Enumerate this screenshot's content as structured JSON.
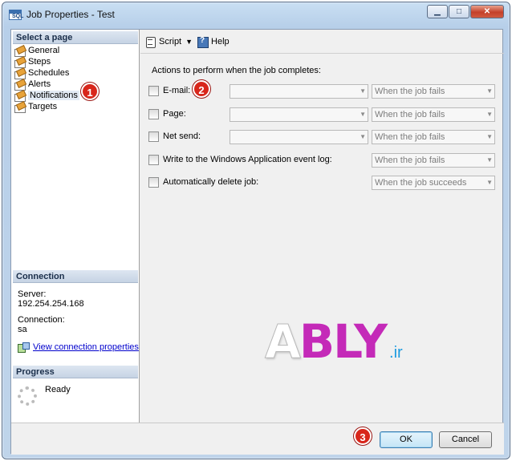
{
  "window": {
    "title": "Job Properties - Test",
    "min_label": "▭",
    "max_label": "□",
    "close_label": "✕"
  },
  "left_pane": {
    "select_page_header": "Select a page",
    "pages": [
      {
        "label": "General",
        "icon": "page-icon"
      },
      {
        "label": "Steps",
        "icon": "page-icon"
      },
      {
        "label": "Schedules",
        "icon": "page-icon"
      },
      {
        "label": "Alerts",
        "icon": "page-icon"
      },
      {
        "label": "Notifications",
        "icon": "page-icon",
        "selected": true
      },
      {
        "label": "Targets",
        "icon": "page-icon"
      }
    ],
    "connection_header": "Connection",
    "server_label": "Server:",
    "server_value": "192.254.254.168",
    "connection_label": "Connection:",
    "connection_value": "sa",
    "view_connection_link": "View connection properties",
    "progress_header": "Progress",
    "progress_status": "Ready"
  },
  "toolbar": {
    "script_label": "Script",
    "help_label": "Help"
  },
  "main": {
    "actions_label": "Actions to perform when the job completes:",
    "options": [
      {
        "label": "E-mail:",
        "address": "",
        "condition": "When the job fails",
        "has_address": true
      },
      {
        "label": "Page:",
        "address": "",
        "condition": "When the job fails",
        "has_address": true
      },
      {
        "label": "Net send:",
        "address": "",
        "condition": "When the job fails",
        "has_address": true
      },
      {
        "label": "Write to the Windows Application event log:",
        "condition": "When the job fails",
        "has_address": false
      },
      {
        "label": "Automatically delete job:",
        "condition": "When the job succeeds",
        "has_address": false
      }
    ]
  },
  "buttons": {
    "ok_label": "OK",
    "cancel_label": "Cancel"
  },
  "annotations": [
    "1",
    "2",
    "3"
  ],
  "watermark": {
    "a": "A",
    "rest": "BLY",
    "ir": ".ir"
  },
  "colors": {
    "accent_badge": "#d8261b",
    "watermark_pink": "#c42ab8",
    "watermark_blue": "#1d9be0"
  }
}
